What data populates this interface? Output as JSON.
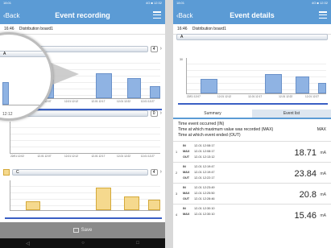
{
  "left": {
    "status": {
      "time": "18:01",
      "right": "4G ■ 12:32"
    },
    "header": {
      "back_label": "Back",
      "title": "Event recording"
    },
    "board": {
      "time": "16:46",
      "name": "Distribution board1"
    },
    "sections": [
      {
        "label": "A",
        "count": "4",
        "ticks": [
          "22/01 12:07",
          "12-01 12:07",
          "12-01 12:12",
          "12-01 12:17",
          "12-01 12:22",
          "12-01 12:27"
        ]
      },
      {
        "label": "",
        "count": "0",
        "ticks": [
          "22/01 12:02",
          "12-01 12:07",
          "12-01 12:12",
          "12-01 12:17",
          "12-01 12:22",
          "12-01 12:27"
        ]
      },
      {
        "label": "C",
        "count": "4",
        "ticks": [
          "22/01 12:02",
          "12-01 12:07",
          "12-01 12:12",
          "12-01 12:17",
          "12-01 12:22",
          "12-01 12:27"
        ]
      }
    ],
    "save_label": "Save",
    "magnifier": {
      "head": "A",
      "tick": "12:12"
    }
  },
  "right": {
    "status": {
      "time": "18:01",
      "right": "4G ■ 12:32"
    },
    "header": {
      "back_label": "Back",
      "title": "Event details"
    },
    "board": {
      "time": "16:46",
      "name": "Distribution board1"
    },
    "section_label": "A",
    "ticks": [
      "22/01 12:07",
      "12-01 12:12",
      "12-01 12:17",
      "12-01 12:22",
      "12-01 12:27"
    ],
    "tabs": [
      "Summary",
      "Event list"
    ],
    "legend": {
      "in": "Time event occurred (IN)",
      "max": "Time at which maximum value was recorded (MAX)",
      "max_tag": "MAX",
      "out": "Time at which event ended (OUT)"
    },
    "row_labels": {
      "in": "IN",
      "max": "MAX",
      "out": "OUT"
    },
    "events": [
      {
        "idx": "1",
        "in": "12-01 12:08:17",
        "max": "12-01 12:08:17",
        "out": "12-01 12:13:12",
        "value": "18.71",
        "unit": "mA"
      },
      {
        "idx": "2",
        "in": "12-01 12:19:47",
        "max": "12-01 12:19:47",
        "out": "12-01 12:22:17",
        "value": "23.84",
        "unit": "mA"
      },
      {
        "idx": "3",
        "in": "12-01 12:23:49",
        "max": "12-01 12:25:50",
        "out": "12-01 12:28:46",
        "value": "20.8",
        "unit": "mA"
      },
      {
        "idx": "4",
        "in": "12-01 12:30:10",
        "max": "12-01 12:30:10",
        "out": "",
        "value": "15.46",
        "unit": "mA"
      }
    ]
  },
  "colors": {
    "accent": "#5b9bd5",
    "bar_blue": "#8fb3e3",
    "bar_yellow": "#f5d98e",
    "line_blue": "#3a5fc4",
    "highlight": "#d22"
  }
}
